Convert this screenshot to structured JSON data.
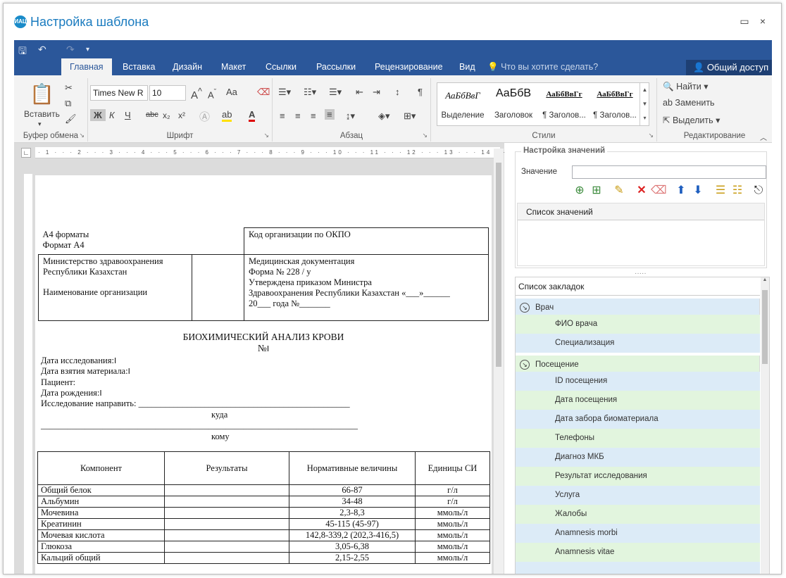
{
  "window": {
    "title": "Настройка шаблона",
    "logo_text": "ИАЦ",
    "minimize": "▭",
    "close": "×"
  },
  "qat": {
    "save": "🖫",
    "undo": "↶",
    "redo": "↷",
    "more": "▾"
  },
  "tabs": [
    "Главная",
    "Вставка",
    "Дизайн",
    "Макет",
    "Ссылки",
    "Рассылки",
    "Рецензирование",
    "Вид"
  ],
  "tell_me": "Что вы хотите сделать?",
  "share": "Общий доступ",
  "ribbon": {
    "clipboard": {
      "label": "Буфер обмена",
      "paste": "Вставить"
    },
    "font": {
      "label": "Шрифт",
      "font_name": "Times New R",
      "font_size": "10",
      "bold": "Ж",
      "italic": "К",
      "underline": "Ч",
      "strike": "abc",
      "sub": "x₂",
      "sup": "x²",
      "case": "Aa"
    },
    "paragraph": {
      "label": "Абзац"
    },
    "styles": {
      "label": "Стили",
      "items": [
        {
          "preview": "АаБбВвГ",
          "name": "Выделение"
        },
        {
          "preview": "АаБбВ",
          "name": "Заголовок"
        },
        {
          "preview": "АаБбВвГг",
          "name": "¶ Заголов..."
        },
        {
          "preview": "АаБбВвГг",
          "name": "¶ Заголов..."
        }
      ]
    },
    "editing": {
      "label": "Редактирование",
      "find": "Найти",
      "replace": "Заменить",
      "select": "Выделить"
    }
  },
  "document": {
    "header_table": {
      "r1c1a": "А4 форматы",
      "r1c1b": "Формат А4",
      "r1c2": "Код организации по ОКПО",
      "r2c1a": "Министерство здравоохранения",
      "r2c1b": "Республики Казахстан",
      "r2c1c": "Наименование организации",
      "r2c3a": "Медицинская документация",
      "r2c3b": "Форма № 228 / у",
      "r2c3c": "Утверждена приказом Министра",
      "r2c3d": "Здравоохранения Республики Казахстан «___»______",
      "r2c3e": "20___ года   №_______"
    },
    "title": "БИОХИМИЧЕСКИЙ АНАЛИЗ КРОВИ",
    "number": "№",
    "fields": {
      "date_research": "Дата исследования:",
      "date_material": "Дата взятия материала:",
      "patient": "Пациент:",
      "birth": "Дата рождения:",
      "send": "Исследование направить: ________________________________________________",
      "where": "куда",
      "line2": "________________________________________________________________________",
      "whom": "кому"
    },
    "results_headers": [
      "Компонент",
      "Результаты",
      "Нормативные величины",
      "Единицы СИ"
    ],
    "results_rows": [
      [
        "Общий белок",
        "",
        "66-87",
        "г/л"
      ],
      [
        "Альбумин",
        "",
        "34-48",
        "г/л"
      ],
      [
        "Мочевина",
        "",
        "2,3-8,3",
        "ммоль/л"
      ],
      [
        "Креатинин",
        "",
        "45-115   (45-97)",
        "ммоль/л"
      ],
      [
        "Мочевая кислота",
        "",
        "142,8-339,2  (202,3-416,5)",
        "ммоль/л"
      ],
      [
        "Глюкоза",
        "",
        "3,05-6,38",
        "ммоль/л"
      ],
      [
        "Кальций общий",
        "",
        "2,15-2,55",
        "ммоль/л"
      ]
    ]
  },
  "values_panel": {
    "title": "Настройка значений",
    "value_label": "Значение",
    "value_input": "",
    "list_header": "Список значений"
  },
  "bookmarks": {
    "header": "Список закладок",
    "items": [
      {
        "text": "Врач",
        "group": true,
        "color": "blue"
      },
      {
        "text": "ФИО врача",
        "group": false,
        "color": "green"
      },
      {
        "text": "Специализация",
        "group": false,
        "color": "blue"
      },
      {
        "text": "Посещение",
        "group": true,
        "color": "green"
      },
      {
        "text": "ID посещения",
        "group": false,
        "color": "blue"
      },
      {
        "text": "Дата посещения",
        "group": false,
        "color": "green"
      },
      {
        "text": "Дата забора биоматериала",
        "group": false,
        "color": "blue"
      },
      {
        "text": "Телефоны",
        "group": false,
        "color": "green"
      },
      {
        "text": "Диагноз МКБ",
        "group": false,
        "color": "blue"
      },
      {
        "text": "Результат исследования",
        "group": false,
        "color": "green"
      },
      {
        "text": "Услуга",
        "group": false,
        "color": "blue"
      },
      {
        "text": "Жалобы",
        "group": false,
        "color": "green"
      },
      {
        "text": "Anamnesis morbi",
        "group": false,
        "color": "blue"
      },
      {
        "text": "Anamnesis vitae",
        "group": false,
        "color": "green"
      },
      {
        "text": "",
        "group": false,
        "color": "blue"
      }
    ]
  },
  "colors": {
    "ribbon": "#2b579a",
    "title": "#1a7bbf",
    "row_blue": "#dcebf7",
    "row_green": "#e2f5de"
  }
}
